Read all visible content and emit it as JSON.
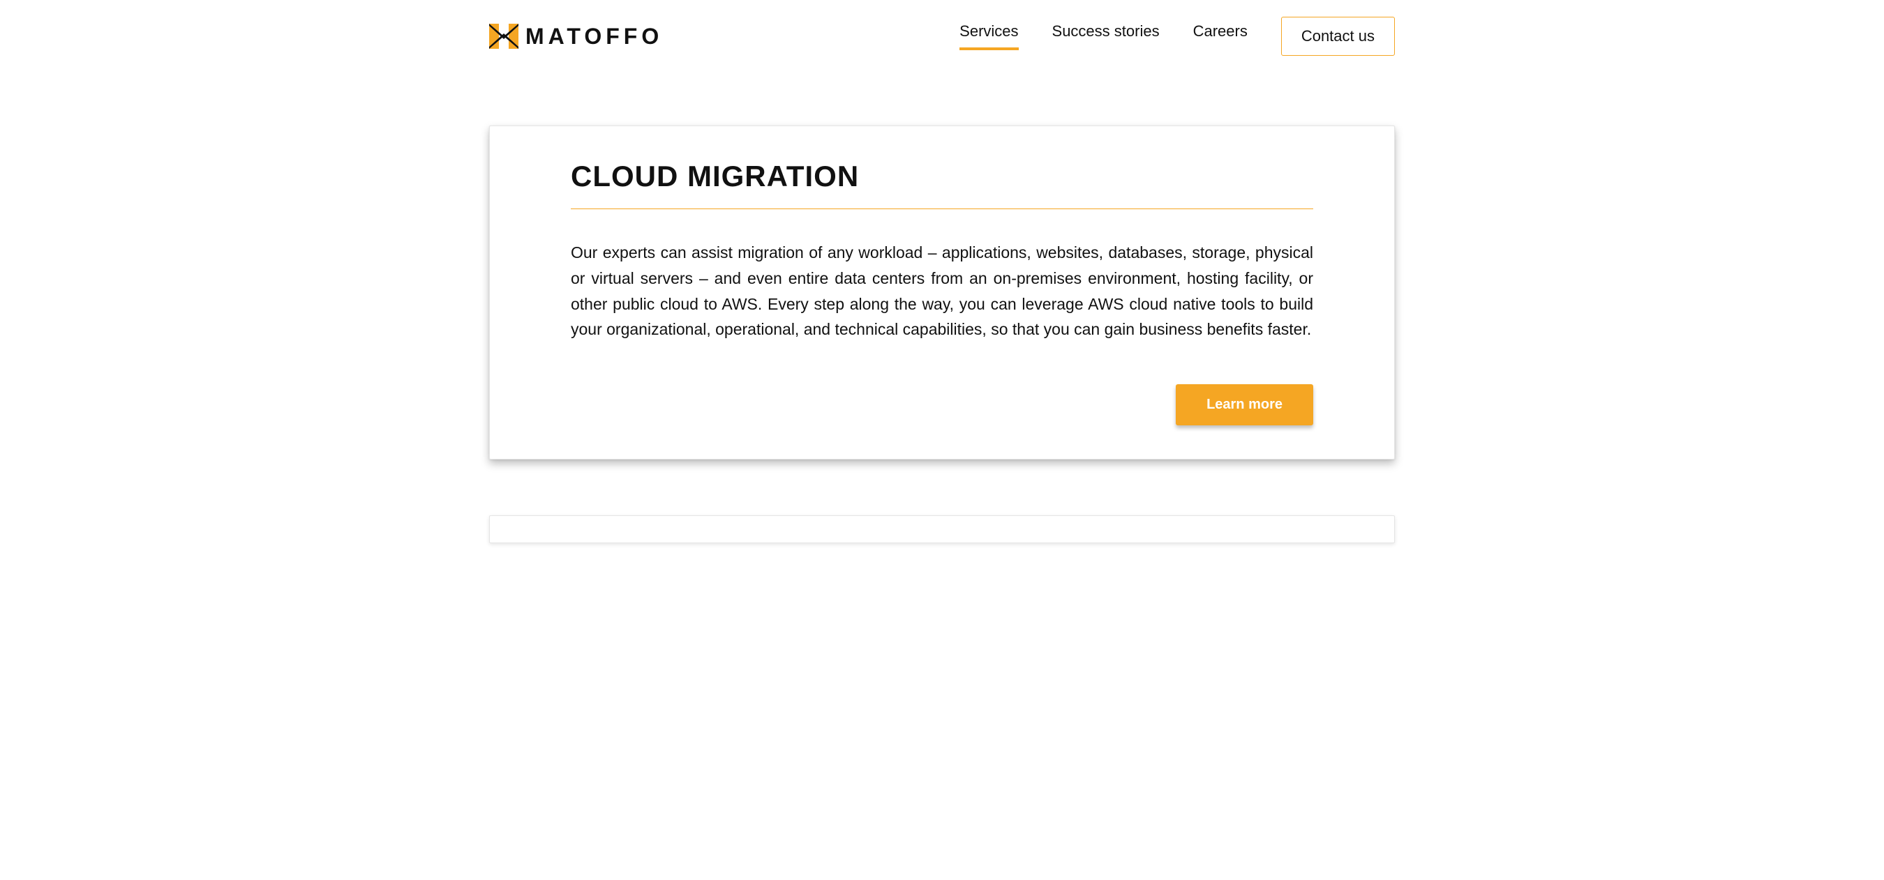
{
  "header": {
    "brand": "MATOFFO",
    "nav": {
      "services": "Services",
      "success_stories": "Success stories",
      "careers": "Careers"
    },
    "contact": "Contact us"
  },
  "card": {
    "title": "CLOUD MIGRATION",
    "body": "Our experts can assist migration of any workload – applications, websites, databases, storage, physical or virtual servers – and even entire data centers from an on-premises environment, hosting facility, or other public cloud to AWS. Every step along the way, you can leverage AWS cloud native tools to build your organizational, operational, and technical capabilities, so that you can gain business benefits faster.",
    "learn_more": "Learn more"
  },
  "colors": {
    "accent": "#f5a623"
  }
}
